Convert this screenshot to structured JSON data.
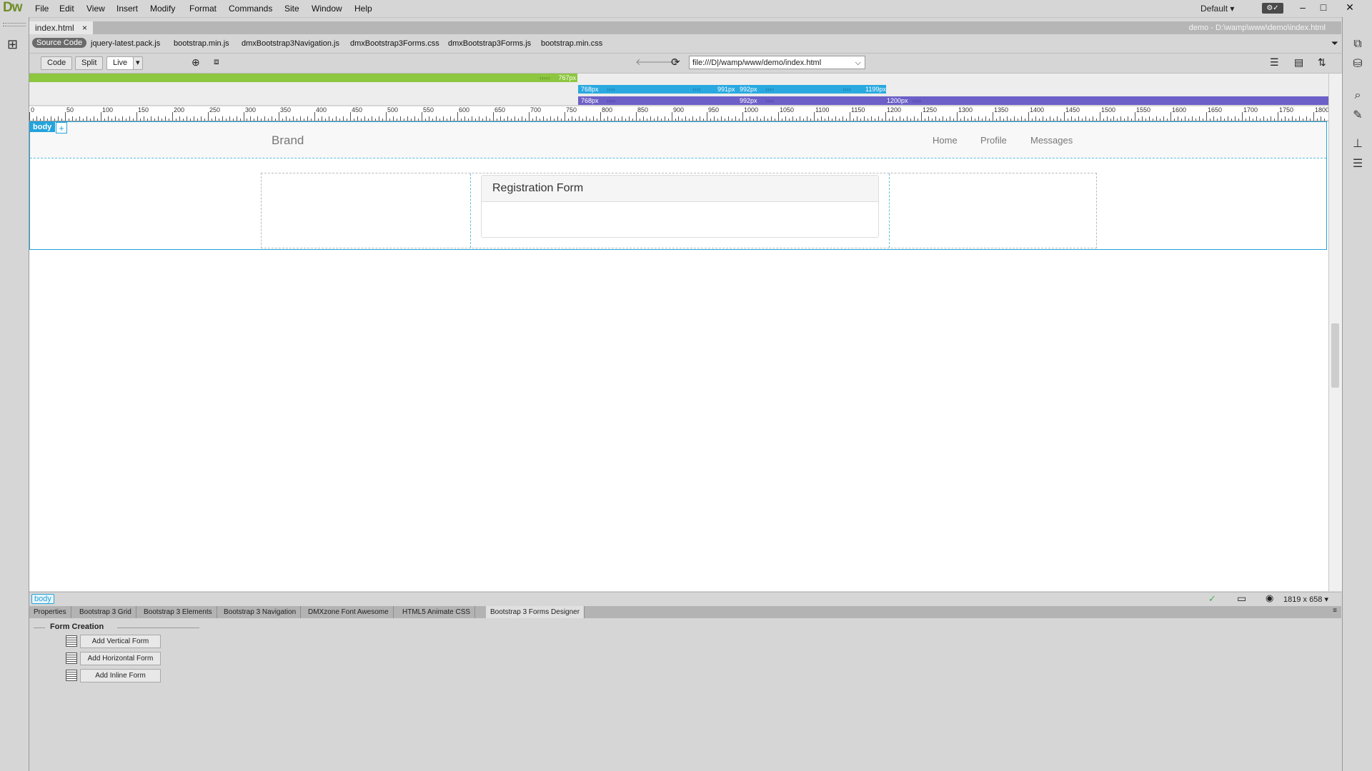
{
  "app": {
    "logo": "Dw"
  },
  "menu": [
    "File",
    "Edit",
    "View",
    "Insert",
    "Modify",
    "Format",
    "Commands",
    "Site",
    "Window",
    "Help"
  ],
  "workspace": "Default",
  "window_controls": {
    "minimize": "–",
    "maximize": "□",
    "close": "✕"
  },
  "document": {
    "tab_label": "index.html",
    "close_glyph": "×",
    "path": "demo - D:\\wamp\\www\\demo\\index.html"
  },
  "related_files": {
    "source_code": "Source Code",
    "files": [
      "jquery-latest.pack.js",
      "bootstrap.min.js",
      "dmxBootstrap3Navigation.js",
      "dmxBootstrap3Forms.css",
      "dmxBootstrap3Forms.js",
      "bootstrap.min.css"
    ]
  },
  "toolbar": {
    "code": "Code",
    "split": "Split",
    "live": "Live",
    "live_arrow": "▾",
    "url": "file:///D|/wamp/www/demo/index.html",
    "url_arrow": "⌵"
  },
  "media_queries": {
    "green": "767px",
    "blue_start": "768px",
    "blue_mid_a": "991px",
    "blue_mid_b": "992px",
    "blue_end": "1199px",
    "purple_a": "768px",
    "purple_b": "992px",
    "purple_c": "1200px"
  },
  "ruler_labels": [
    "0",
    "50",
    "100",
    "150",
    "200",
    "250",
    "300",
    "350",
    "400",
    "450",
    "500",
    "550",
    "600",
    "650",
    "700",
    "750",
    "800",
    "850",
    "900",
    "950",
    "1000",
    "1050",
    "1100",
    "1150",
    "1200",
    "1250",
    "1300",
    "1350",
    "1400",
    "1450",
    "1500",
    "1550",
    "1600",
    "1650",
    "1700",
    "1750",
    "1800"
  ],
  "design": {
    "body_tag": "body",
    "plus": "+",
    "brand": "Brand",
    "nav": [
      "Home",
      "Profile",
      "Messages"
    ],
    "panel_title": "Registration Form"
  },
  "status": {
    "tag": "body",
    "dims": "1819 x 658 ▾"
  },
  "panel_tabs": [
    "Properties",
    "Bootstrap 3 Grid",
    "Bootstrap 3 Elements",
    "Bootstrap 3 Navigation",
    "DMXzone Font Awesome",
    "HTML5 Animate CSS",
    "Bootstrap 3 Forms Designer"
  ],
  "active_panel_tab": "Bootstrap 3 Forms Designer",
  "form_creation": {
    "title": "Form Creation",
    "buttons": [
      "Add Vertical Form",
      "Add Horizontal Form",
      "Add Inline Form"
    ]
  },
  "colors": {
    "accent": "#23a3dc",
    "green": "#8dc63f",
    "blue": "#29a9e0",
    "purple": "#6c5fc7"
  }
}
